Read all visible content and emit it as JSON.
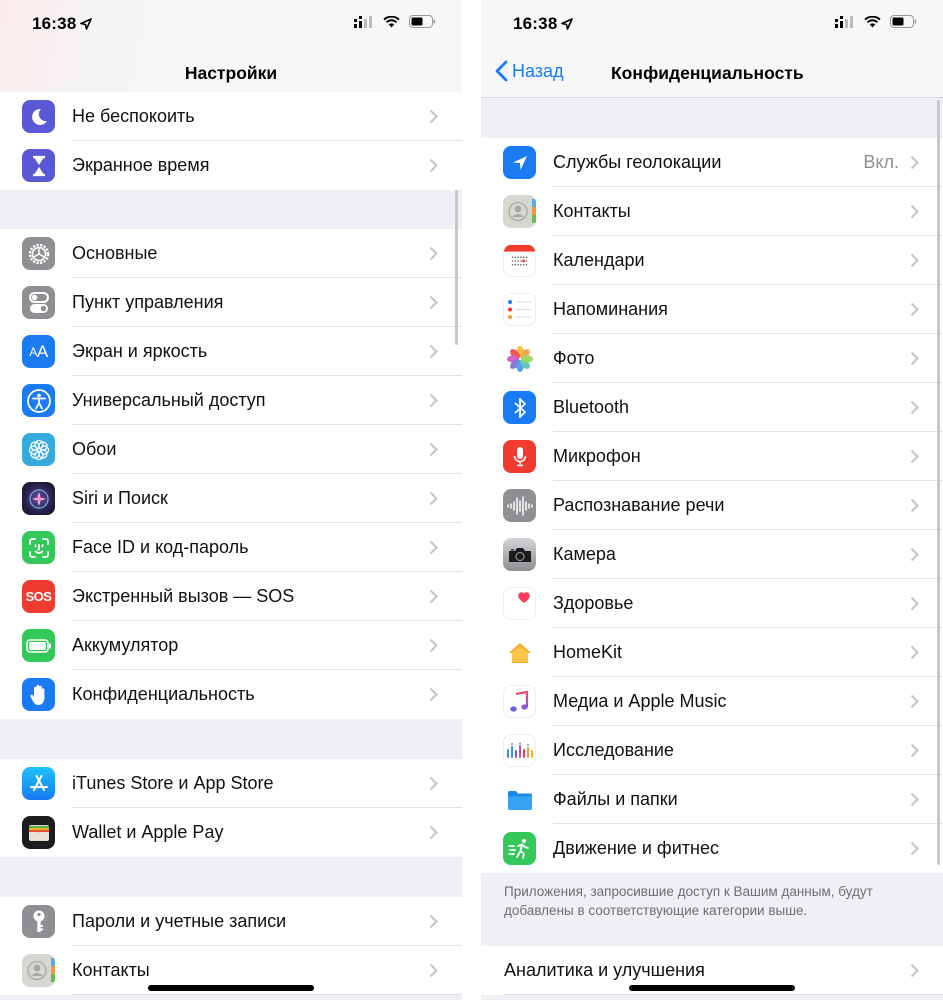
{
  "status_bar": {
    "time": "16:38"
  },
  "left_screen": {
    "title": "Настройки",
    "groups": [
      {
        "items": [
          {
            "label": "Не беспокоить",
            "icon": "moon-icon",
            "color": "#5b58d6"
          },
          {
            "label": "Экранное время",
            "icon": "hourglass-icon",
            "color": "#5b58d6"
          }
        ]
      },
      {
        "items": [
          {
            "label": "Основные",
            "icon": "gear-icon",
            "color": "#8e8e93"
          },
          {
            "label": "Пункт управления",
            "icon": "toggles-icon",
            "color": "#8e8e93"
          },
          {
            "label": "Экран и яркость",
            "icon": "text-size-icon",
            "color": "#1a7bf2"
          },
          {
            "label": "Универсальный доступ",
            "icon": "accessibility-icon",
            "color": "#1a7bf2"
          },
          {
            "label": "Обои",
            "icon": "flower-icon",
            "color": "#35aadc"
          },
          {
            "label": "Siri и Поиск",
            "icon": "siri-icon",
            "color": "#1d1b3a"
          },
          {
            "label": "Face ID и код-пароль",
            "icon": "face-id-icon",
            "color": "#34c759"
          },
          {
            "label": "Экстренный вызов — SOS",
            "icon": "sos-icon",
            "color": "#ef3b30",
            "icon_text": "SOS"
          },
          {
            "label": "Аккумулятор",
            "icon": "battery-icon",
            "color": "#34c759"
          },
          {
            "label": "Конфиденциальность",
            "icon": "hand-icon",
            "color": "#1a7bf2"
          }
        ]
      },
      {
        "items": [
          {
            "label": "iTunes Store и App Store",
            "icon": "app-store-icon",
            "color": "#1a8cf5"
          },
          {
            "label": "Wallet и Apple Pay",
            "icon": "wallet-icon",
            "color": "#1c1c1e"
          }
        ]
      },
      {
        "items": [
          {
            "label": "Пароли и учетные записи",
            "icon": "key-icon",
            "color": "#8e8e93"
          },
          {
            "label": "Контакты",
            "icon": "contacts-icon",
            "color": "#d8d6d0"
          }
        ]
      }
    ]
  },
  "right_screen": {
    "back_label": "Назад",
    "title": "Конфиденциальность",
    "items": [
      {
        "label": "Службы геолокации",
        "value": "Вкл.",
        "icon": "location-arrow-icon",
        "color": "#1a7bf2"
      },
      {
        "label": "Контакты",
        "icon": "contacts-icon",
        "color": "#d8d6d0"
      },
      {
        "label": "Календари",
        "icon": "calendar-icon",
        "color": "#ffffff"
      },
      {
        "label": "Напоминания",
        "icon": "reminders-icon",
        "color": "#ffffff"
      },
      {
        "label": "Фото",
        "icon": "photos-icon",
        "color": "#ffffff"
      },
      {
        "label": "Bluetooth",
        "icon": "bluetooth-icon",
        "color": "#1a7bf2"
      },
      {
        "label": "Микрофон",
        "icon": "microphone-icon",
        "color": "#ef3b30"
      },
      {
        "label": "Распознавание речи",
        "icon": "waveform-icon",
        "color": "#8e8e93"
      },
      {
        "label": "Камера",
        "icon": "camera-icon",
        "color": "#9a9a9e"
      },
      {
        "label": "Здоровье",
        "icon": "heart-icon",
        "color": "#ffffff"
      },
      {
        "label": "HomeKit",
        "icon": "home-icon",
        "color": "#ffffff"
      },
      {
        "label": "Медиа и Apple Music",
        "icon": "music-note-icon",
        "color": "#ffffff"
      },
      {
        "label": "Исследование",
        "icon": "research-icon",
        "color": "#ffffff"
      },
      {
        "label": "Файлы и папки",
        "icon": "folder-icon",
        "color": "#ffffff"
      },
      {
        "label": "Движение и фитнес",
        "icon": "running-icon",
        "color": "#34c759"
      }
    ],
    "footer_note": "Приложения, запросившие доступ к Вашим данным, будут добавлены в соответствующие категории выше.",
    "bottom_items": [
      {
        "label": "Аналитика и улучшения"
      }
    ]
  }
}
